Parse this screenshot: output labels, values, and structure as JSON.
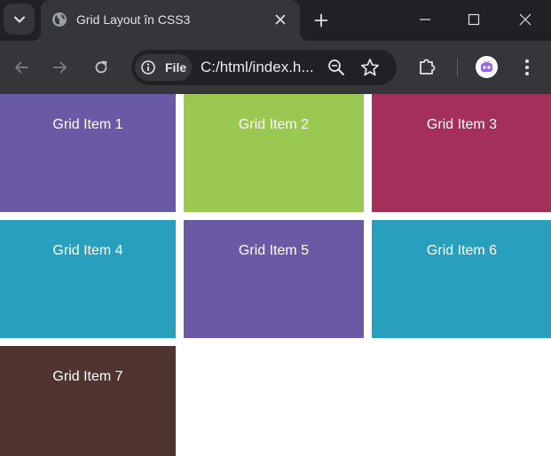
{
  "browser": {
    "tab": {
      "title": "Grid Layout în CSS3",
      "favicon": "globe-icon"
    },
    "address_bar": {
      "security_chip_label": "File",
      "url": "C:/html/index.h..."
    },
    "colors": {
      "tabstrip_bg": "#1f2124",
      "toolbar_bg": "#35363a",
      "omnibox_bg": "#202124",
      "text": "#e3e3e3"
    }
  },
  "page": {
    "grid_items": [
      {
        "label": "Grid Item 1",
        "color": "#6a5aa6"
      },
      {
        "label": "Grid Item 2",
        "color": "#9bc851"
      },
      {
        "label": "Grid Item 3",
        "color": "#a42f5b"
      },
      {
        "label": "Grid Item 4",
        "color": "#289fbc"
      },
      {
        "label": "Grid Item 5",
        "color": "#6a5aa6"
      },
      {
        "label": "Grid Item 6",
        "color": "#289fbc"
      },
      {
        "label": "Grid Item 7",
        "color": "#4f342f"
      }
    ]
  }
}
